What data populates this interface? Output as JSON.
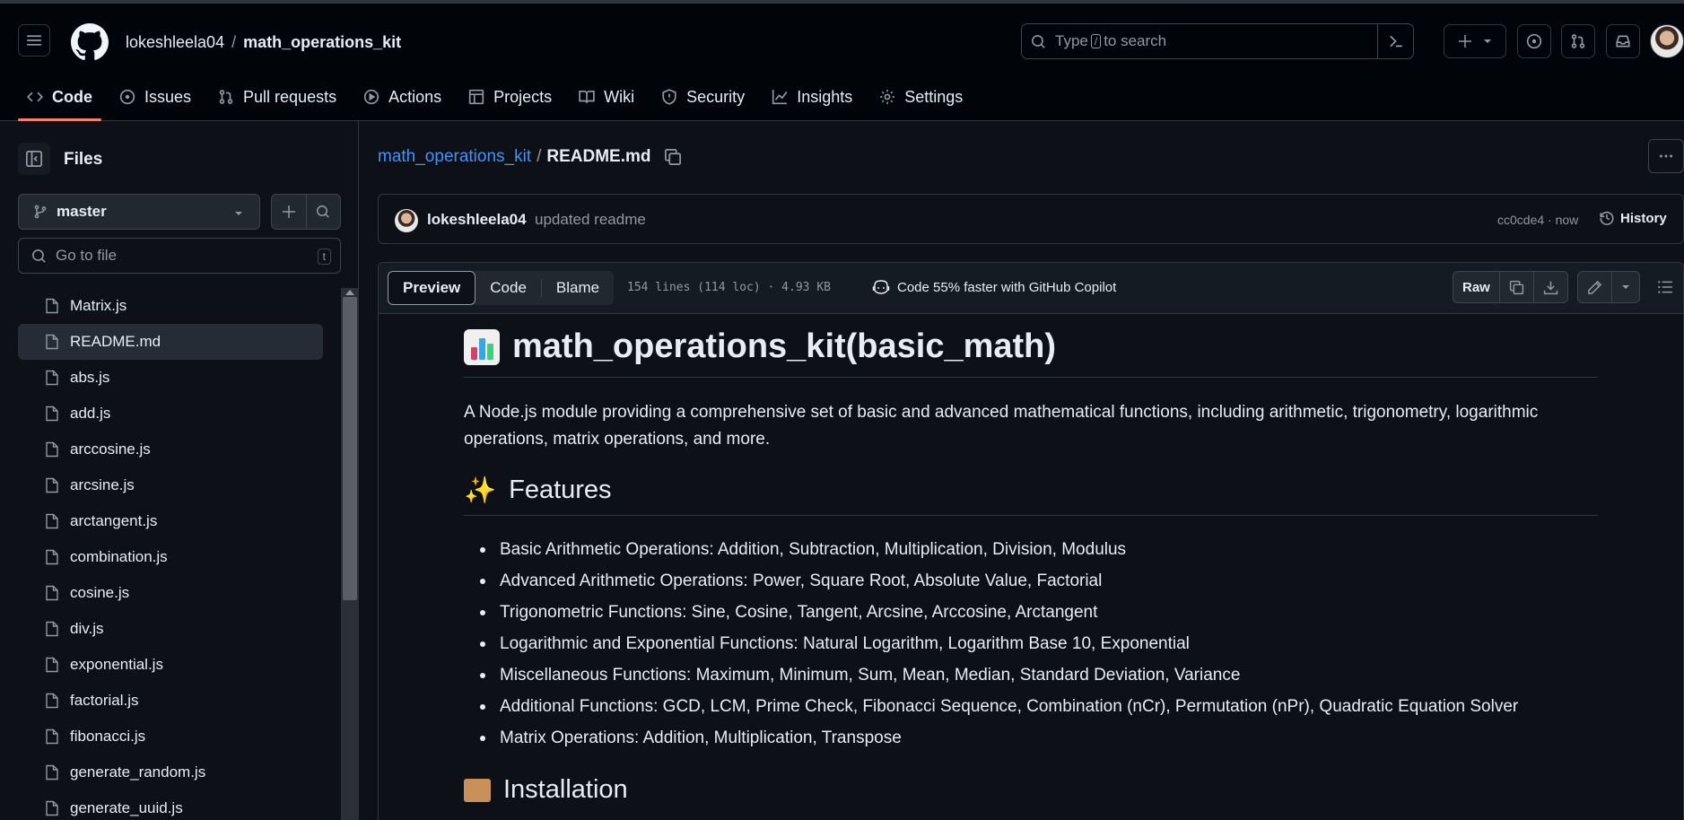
{
  "header": {
    "owner": "lokeshleela04",
    "separator": "/",
    "repo": "math_operations_kit",
    "search_prefix": "Type",
    "search_key": "/",
    "search_suffix": "to search"
  },
  "tabs": [
    {
      "label": "Code",
      "icon": "code-icon"
    },
    {
      "label": "Issues",
      "icon": "issue-icon"
    },
    {
      "label": "Pull requests",
      "icon": "pull-request-icon"
    },
    {
      "label": "Actions",
      "icon": "play-icon"
    },
    {
      "label": "Projects",
      "icon": "table-icon"
    },
    {
      "label": "Wiki",
      "icon": "book-icon"
    },
    {
      "label": "Security",
      "icon": "shield-icon"
    },
    {
      "label": "Insights",
      "icon": "graph-icon"
    },
    {
      "label": "Settings",
      "icon": "gear-icon"
    }
  ],
  "sidebar": {
    "title": "Files",
    "branch": "master",
    "goto_placeholder": "Go to file",
    "goto_key": "t",
    "files": [
      "Matrix.js",
      "README.md",
      "abs.js",
      "add.js",
      "arccosine.js",
      "arcsine.js",
      "arctangent.js",
      "combination.js",
      "cosine.js",
      "div.js",
      "exponential.js",
      "factorial.js",
      "fibonacci.js",
      "generate_random.js",
      "generate_uuid.js"
    ],
    "selected_file": "README.md"
  },
  "breadcrumb": {
    "repo_link": "math_operations_kit",
    "separator": "/",
    "file": "README.md"
  },
  "commit": {
    "user": "lokeshleela04",
    "message": "updated readme",
    "sha_time": "cc0cde4 · now",
    "history": "History"
  },
  "file_toolbar": {
    "preview": "Preview",
    "code": "Code",
    "blame": "Blame",
    "meta": "154 lines (114 loc) · 4.93 KB",
    "copilot": "Code 55% faster with GitHub Copilot",
    "raw": "Raw"
  },
  "readme": {
    "title": "math_operations_kit(basic_math)",
    "description": "A Node.js module providing a comprehensive set of basic and advanced mathematical functions, including arithmetic, trigonometry, logarithmic operations, matrix operations, and more.",
    "features_heading": "Features",
    "features": [
      "Basic Arithmetic Operations: Addition, Subtraction, Multiplication, Division, Modulus",
      "Advanced Arithmetic Operations: Power, Square Root, Absolute Value, Factorial",
      "Trigonometric Functions: Sine, Cosine, Tangent, Arcsine, Arccosine, Arctangent",
      "Logarithmic and Exponential Functions: Natural Logarithm, Logarithm Base 10, Exponential",
      "Miscellaneous Functions: Maximum, Minimum, Sum, Mean, Median, Standard Deviation, Variance",
      "Additional Functions: GCD, LCM, Prime Check, Fibonacci Sequence, Combination (nCr), Permutation (nPr), Quadratic Equation Solver",
      "Matrix Operations: Addition, Multiplication, Transpose"
    ],
    "installation_heading": "Installation"
  },
  "colors": {
    "accent": "#4493f8",
    "active_tab_underline": "#f78166",
    "background": "#0d1117",
    "header_bg": "#010409"
  }
}
